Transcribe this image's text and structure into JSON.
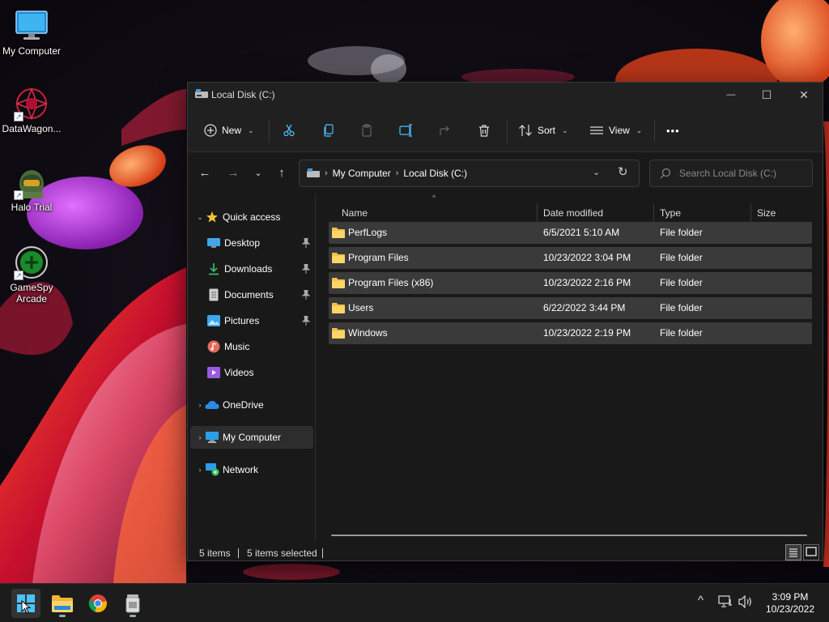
{
  "desktop": {
    "icons": [
      {
        "label": "My Computer",
        "icon": "monitor-icon"
      },
      {
        "label": "DataWagon...",
        "icon": "datawagon-icon"
      },
      {
        "label": "Halo Trial",
        "icon": "halo-icon"
      },
      {
        "label": "GameSpy Arcade",
        "icon": "gamespy-icon"
      }
    ]
  },
  "window": {
    "title": "Local Disk (C:)",
    "controls": {
      "minimize": "—",
      "maximize": "☐",
      "close": "✕"
    },
    "toolbar": {
      "new_label": "New",
      "sort_label": "Sort",
      "view_label": "View",
      "more_label": "•••"
    },
    "address": {
      "crumbs": [
        "My Computer",
        "Local Disk (C:)"
      ],
      "search_placeholder": "Search Local Disk (C:)"
    },
    "nav": {
      "quick_access": "Quick access",
      "items": [
        {
          "label": "Desktop",
          "pinned": true
        },
        {
          "label": "Downloads",
          "pinned": true
        },
        {
          "label": "Documents",
          "pinned": true
        },
        {
          "label": "Pictures",
          "pinned": true
        },
        {
          "label": "Music",
          "pinned": false
        },
        {
          "label": "Videos",
          "pinned": false
        }
      ],
      "onedrive": "OneDrive",
      "my_computer": "My Computer",
      "network": "Network"
    },
    "columns": {
      "name": "Name",
      "date": "Date modified",
      "type": "Type",
      "size": "Size"
    },
    "files": [
      {
        "name": "PerfLogs",
        "date": "6/5/2021 5:10 AM",
        "type": "File folder"
      },
      {
        "name": "Program Files",
        "date": "10/23/2022 3:04 PM",
        "type": "File folder"
      },
      {
        "name": "Program Files (x86)",
        "date": "10/23/2022 2:16 PM",
        "type": "File folder"
      },
      {
        "name": "Users",
        "date": "6/22/2022 3:44 PM",
        "type": "File folder"
      },
      {
        "name": "Windows",
        "date": "10/23/2022 2:19 PM",
        "type": "File folder"
      }
    ],
    "status": {
      "count": "5 items",
      "selected": "5 items selected"
    }
  },
  "taskbar": {
    "clock": {
      "time": "3:09 PM",
      "date": "10/23/2022"
    },
    "tray": {
      "chevron": "^"
    }
  },
  "colors": {
    "accent": "#4cc2ff",
    "folder": "#f0c24c",
    "window_bg": "#191919",
    "row_selected": "#3a3a3a"
  }
}
